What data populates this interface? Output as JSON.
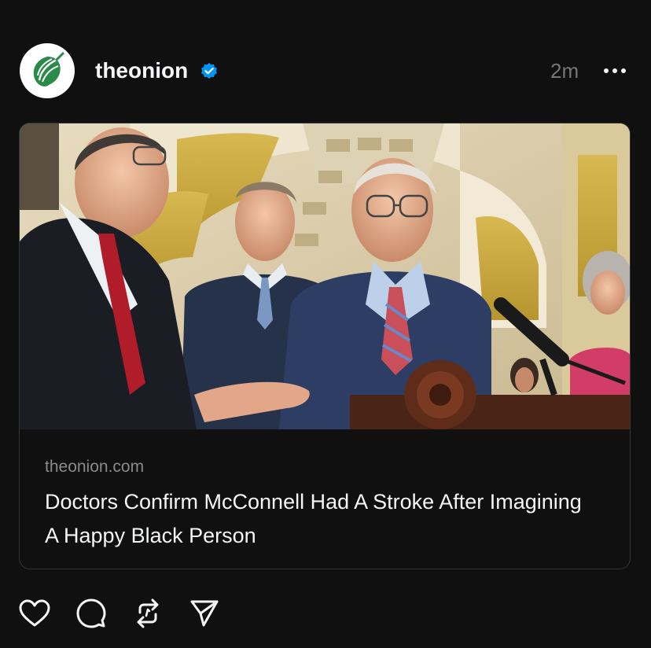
{
  "post": {
    "author": "theonion",
    "verified_icon": "verified-badge-icon",
    "timestamp": "2m",
    "more_icon": "more-options-icon",
    "avatar_icon": "onion-logo-icon",
    "link_card": {
      "domain": "theonion.com",
      "title": "Doctors Confirm McConnell Had A Stroke After Imagining A Happy Black Person",
      "image_icon": "article-photo"
    },
    "actions": [
      {
        "icon": "heart-icon",
        "name": "like"
      },
      {
        "icon": "comment-icon",
        "name": "reply"
      },
      {
        "icon": "repost-icon",
        "name": "repost"
      },
      {
        "icon": "send-icon",
        "name": "share"
      }
    ]
  },
  "colors": {
    "background": "#101010",
    "primary_text": "#f3f5f7",
    "secondary_text": "#777777",
    "verified_blue": "#0095f6",
    "onion_green": "#2a8a4a",
    "card_border": "#333638"
  }
}
